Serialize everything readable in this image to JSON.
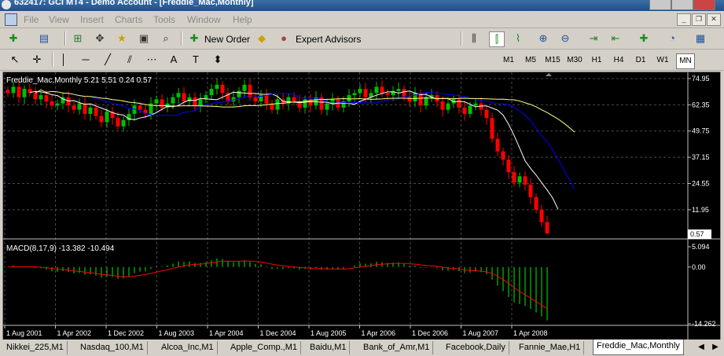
{
  "window": {
    "title": "632417: GCI MT4 - Demo Account - [Freddie_Mac,Monthly]"
  },
  "menu": {
    "items": [
      "File",
      "View",
      "Insert",
      "Charts",
      "Tools",
      "Window",
      "Help"
    ]
  },
  "toolbar": {
    "new_order_label": "New Order",
    "expert_advisors_label": "Expert Advisors"
  },
  "timeframes": {
    "items": [
      "M1",
      "M5",
      "M15",
      "M30",
      "H1",
      "H4",
      "D1",
      "W1",
      "MN"
    ],
    "selected": "MN"
  },
  "chart": {
    "header": "Freddie_Mac,Monthly  5.21 5.51 0.24 0.57",
    "price_ticks": [
      "74.95",
      "62.35",
      "49.75",
      "37.15",
      "24.55",
      "11.95"
    ],
    "current_price": "0.57",
    "macd_header": "MACD(8,17,9) -13.382 -10.494",
    "macd_ticks": [
      "5.094",
      "0.00",
      "-14.262"
    ],
    "x_labels": [
      "1 Aug 2001",
      "1 Apr 2002",
      "1 Dec 2002",
      "1 Aug 2003",
      "1 Apr 2004",
      "1 Dec 2004",
      "1 Aug 2005",
      "1 Apr 2006",
      "1 Dec 2006",
      "1 Aug 2007",
      "1 Apr 2008"
    ],
    "colors": {
      "background": "#000000",
      "bull": "#00c000",
      "bear": "#ff0000",
      "doji": "#ffffff",
      "ma_fast": "#ffffff",
      "ma_mid": "#0000ff",
      "ma_slow": "#ffff80",
      "macd_hist": "#00a000",
      "macd_signal": "#ff0000"
    }
  },
  "chart_data": {
    "type": "candlestick",
    "symbol": "Freddie_Mac",
    "period": "Monthly",
    "ohlc_last": {
      "open": 5.21,
      "high": 5.51,
      "low": 0.24,
      "close": 0.57
    },
    "ylim": [
      0.57,
      74.95
    ],
    "closes": [
      68,
      71,
      66,
      70,
      68,
      65,
      67,
      64,
      62,
      63,
      66,
      62,
      60,
      63,
      58,
      61,
      57,
      54,
      59,
      56,
      52,
      55,
      58,
      62,
      60,
      58,
      63,
      65,
      61,
      63,
      66,
      68,
      64,
      66,
      62,
      65,
      67,
      70,
      72,
      68,
      64,
      66,
      69,
      72,
      66,
      64,
      67,
      63,
      60,
      65,
      63,
      66,
      64,
      61,
      65,
      62,
      66,
      60,
      63,
      65,
      61,
      64,
      67,
      68,
      70,
      66,
      68,
      71,
      68,
      67,
      69,
      70,
      66,
      64,
      68,
      62,
      66,
      67,
      64,
      60,
      63,
      65,
      61,
      58,
      62,
      63,
      60,
      56,
      46,
      40,
      36,
      30,
      25,
      28,
      24,
      18,
      12,
      6,
      0.57
    ],
    "macd_ylim": [
      -14.262,
      5.094
    ],
    "macd_last": -13.382,
    "signal_last": -10.494
  },
  "tabs": {
    "items": [
      "Nikkei_225,M1",
      "Nasdaq_100,M1",
      "Alcoa_Inc,M1",
      "Apple_Comp.,M1",
      "Baidu,M1",
      "Bank_of_Amr,M1",
      "Facebook,Daily",
      "Fannie_Mae,H1",
      "Freddie_Mac,Monthly"
    ],
    "active": "Freddie_Mac,Monthly"
  }
}
